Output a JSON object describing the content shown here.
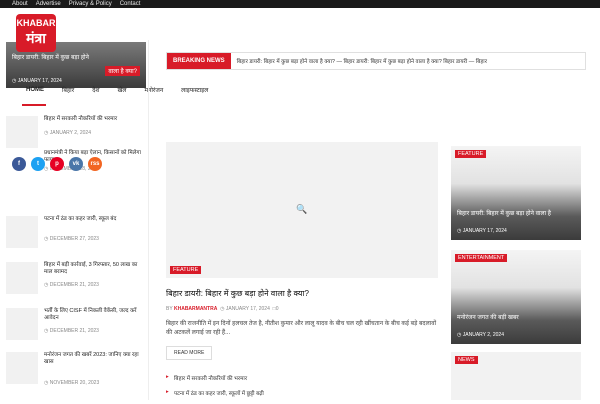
{
  "topbar": {
    "links": [
      "About",
      "Advertise",
      "Privacy & Policy",
      "Contact"
    ]
  },
  "brand": {
    "line1": "KHABAR",
    "line2": "मंत्रा"
  },
  "left_hero": {
    "title": "बिहार डायरी: बिहार में कुछ बड़ा होने",
    "tag": "वाला है क्या?",
    "date": "JANUARY 17, 2024"
  },
  "breaking": {
    "label": "BREAKING NEWS",
    "ticker": "बिहार डायरी: बिहार में कुछ बड़ा होने वाला है क्या? — बिहार डायरी: बिहार में कुछ बड़ा होने वाला है क्या? बिहार डायरी — बिहार"
  },
  "nav": {
    "items": [
      "HOME",
      "बिहार",
      "देश",
      "खेल",
      "मनोरंजन",
      "लाइफस्टाइल"
    ]
  },
  "share": {
    "buttons": [
      "f",
      "t",
      "p",
      "vk",
      "rss"
    ],
    "colors": [
      "#3b5998",
      "#1da1f2",
      "#e60023",
      "#4a76a8",
      "#f26522"
    ]
  },
  "left_list": [
    {
      "title": "बिहार में सरकारी नौकरियों की भरमार",
      "date": "JANUARY 2, 2024"
    },
    {
      "title": "प्रधानमंत्री ने किया बड़ा ऐलान, किसानों को मिलेगा फायदा",
      "date": "DECEMBER 28, 2023"
    },
    {
      "title": "पटना में ठंड का कहर जारी, स्कूल बंद",
      "date": "DECEMBER 27, 2023"
    },
    {
      "title": "बिहार में बड़ी कार्रवाई, 3 गिरफ्तार, 50 लाख का माल बरामद",
      "date": "DECEMBER 21, 2023"
    },
    {
      "title": "भर्ती के लिए CISF में निकली वैकेंसी, जल्द करें आवेदन",
      "date": "DECEMBER 21, 2023"
    },
    {
      "title": "मनोरंजन जगत की खबरें 2023: जानिए क्या रहा खास",
      "date": "NOVEMBER 20, 2023"
    }
  ],
  "featured": {
    "tag": "FEATURE",
    "title": "बिहार डायरी: बिहार में कुछ बड़ा होने वाला है क्या?",
    "author_prefix": "BY",
    "author": "KHABARMANTRA",
    "date": "JANUARY 17, 2024",
    "comments": "0",
    "excerpt": "बिहार की राजनीति में इन दिनों हलचल तेज है, नीतीश कुमार और लालू यादव के बीच चल रही खींचतान के बीच कई बड़े बदलावों की अटकलें लगाई जा रही हैं...",
    "read_more": "READ MORE",
    "search_icon": "search-icon"
  },
  "bullets": [
    "बिहार में सरकारी नौकरियों की भरमार",
    "पटना में ठंड का कहर जारी, स्कूलों में छुट्टी बढ़ी"
  ],
  "right_cards": [
    {
      "tag": "FEATURE",
      "title": "बिहार डायरी: बिहार में कुछ बड़ा होने वाला है",
      "date": "JANUARY 17, 2024"
    },
    {
      "tag": "ENTERTAINMENT",
      "title": "मनोरंजन जगत की बड़ी खबर",
      "date": "JANUARY 2, 2024"
    },
    {
      "tag": "NEWS"
    }
  ]
}
